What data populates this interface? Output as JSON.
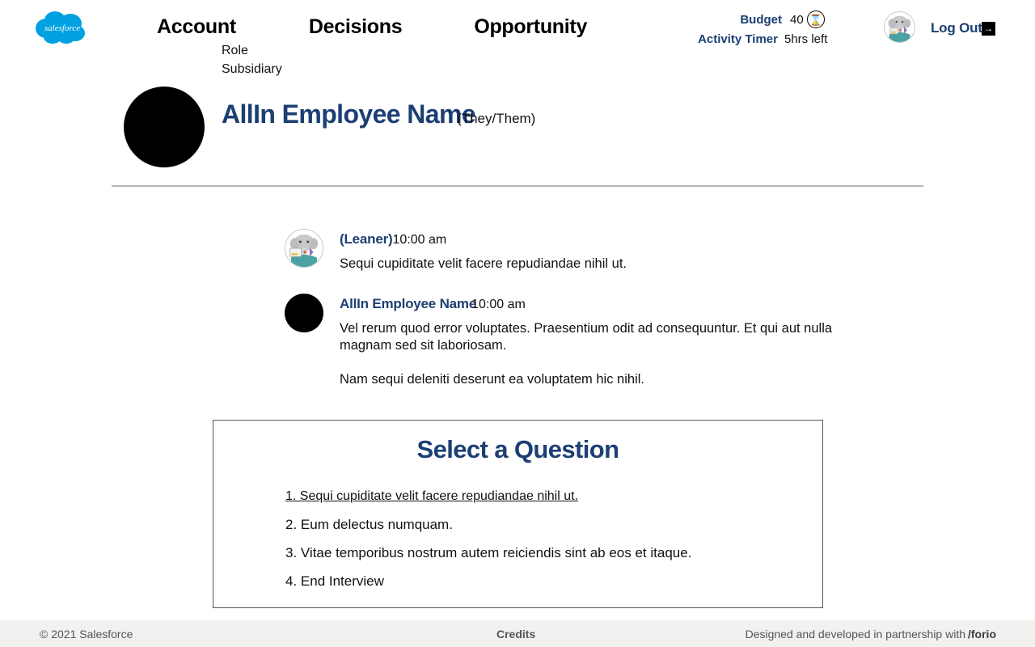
{
  "header": {
    "logo": {
      "name": "salesforce-cloud-logo",
      "text": "salesforce",
      "color": "#00A1E0"
    },
    "nav": [
      {
        "label": "Account"
      },
      {
        "label": "Decisions"
      },
      {
        "label": "Opportunity"
      }
    ],
    "meters": [
      {
        "label": "Budget",
        "value": "40",
        "icon": "hourglass-icon",
        "icon_glyph": "⌛"
      },
      {
        "label": "Activity Timer",
        "value": "5hrs left"
      }
    ],
    "avatar": {
      "name": "user-avatar",
      "alt": "elephant avatar"
    },
    "logout": {
      "label": "Log Out",
      "icon": "logout-arrow-icon",
      "icon_glyph": "→"
    },
    "accent_navy": "#1c3f73"
  },
  "profile": {
    "name": "AllIn Employee Name",
    "pronouns": "(They/Them)",
    "role": "Role",
    "subsidiary": "Subsidiary"
  },
  "chat": {
    "messages": [
      {
        "author": "(Leaner)",
        "time": "10:00 am",
        "avatar": "elephant-avatar",
        "paragraphs": [
          "Sequi cupiditate velit facere repudiandae nihil ut."
        ]
      },
      {
        "author": "AllIn Employee Name",
        "time": "10:00 am",
        "avatar": "solid-black-avatar",
        "paragraphs": [
          "Vel rerum quod error voluptates. Praesentium odit ad consequuntur. Et qui aut nulla magnam sed sit laboriosam.",
          "Nam sequi deleniti deserunt ea voluptatem hic nihil."
        ]
      }
    ]
  },
  "question_panel": {
    "title": "Select a Question",
    "options": [
      {
        "label": "1. Sequi cupiditate velit facere repudiandae nihil ut.",
        "selected": true
      },
      {
        "label": "2. Eum delectus numquam.",
        "selected": false
      },
      {
        "label": "3. Vitae temporibus nostrum autem reiciendis sint ab eos et itaque.",
        "selected": false
      },
      {
        "label": "4. End Interview",
        "selected": false
      }
    ]
  },
  "footer": {
    "copyright": "© 2021 Salesforce",
    "credits": "Credits",
    "partnership": "Designed and developed in partnership with",
    "brand": "/forio"
  }
}
